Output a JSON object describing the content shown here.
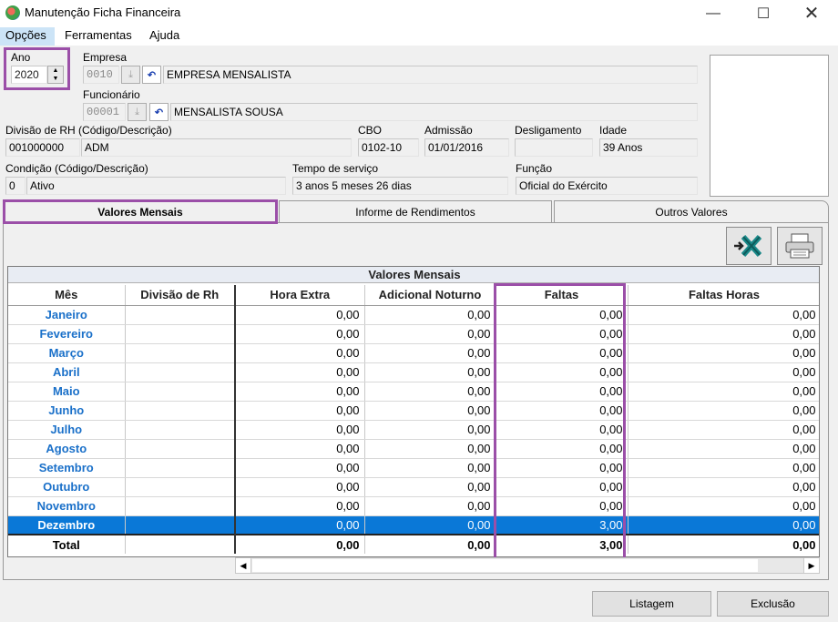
{
  "window": {
    "title": "Manutenção Ficha Financeira",
    "minimize_icon": "minimize-icon",
    "maximize_icon": "maximize-icon",
    "close_icon": "close-icon"
  },
  "menu": [
    "Opções",
    "Ferramentas",
    "Ajuda"
  ],
  "form": {
    "ano_label": "Ano",
    "ano_value": "2020",
    "empresa_label": "Empresa",
    "empresa_code": "0010",
    "empresa_name": "EMPRESA MENSALISTA",
    "funcionario_label": "Funcionário",
    "funcionario_code": "00001",
    "funcionario_name": "MENSALISTA SOUSA",
    "divisao_label": "Divisão de RH (Código/Descrição)",
    "divisao_code": "001000000",
    "divisao_desc": "ADM",
    "cbo_label": "CBO",
    "cbo_value": "0102-10",
    "admissao_label": "Admissão",
    "admissao_value": "01/01/2016",
    "desligamento_label": "Desligamento",
    "desligamento_value": "",
    "idade_label": "Idade",
    "idade_value": "39 Anos",
    "condicao_label": "Condição (Código/Descrição)",
    "condicao_code": "0",
    "condicao_desc": "Ativo",
    "tempo_label": "Tempo de serviço",
    "tempo_value": "3 anos 5 meses 26 dias",
    "funcao_label": "Função",
    "funcao_value": "Oficial do Exército"
  },
  "tabs": [
    "Valores Mensais",
    "Informe de Rendimentos",
    "Outros Valores"
  ],
  "grid": {
    "caption": "Valores Mensais",
    "columns": [
      "Mês",
      "Divisão de Rh",
      "Hora Extra",
      "Adicional Noturno",
      "Faltas",
      "Faltas Horas"
    ],
    "rows": [
      {
        "mes": "Janeiro",
        "divisao": "",
        "hora_extra": "0,00",
        "adicional": "0,00",
        "faltas": "0,00",
        "faltas_horas": "0,00"
      },
      {
        "mes": "Fevereiro",
        "divisao": "",
        "hora_extra": "0,00",
        "adicional": "0,00",
        "faltas": "0,00",
        "faltas_horas": "0,00"
      },
      {
        "mes": "Março",
        "divisao": "",
        "hora_extra": "0,00",
        "adicional": "0,00",
        "faltas": "0,00",
        "faltas_horas": "0,00"
      },
      {
        "mes": "Abril",
        "divisao": "",
        "hora_extra": "0,00",
        "adicional": "0,00",
        "faltas": "0,00",
        "faltas_horas": "0,00"
      },
      {
        "mes": "Maio",
        "divisao": "",
        "hora_extra": "0,00",
        "adicional": "0,00",
        "faltas": "0,00",
        "faltas_horas": "0,00"
      },
      {
        "mes": "Junho",
        "divisao": "",
        "hora_extra": "0,00",
        "adicional": "0,00",
        "faltas": "0,00",
        "faltas_horas": "0,00"
      },
      {
        "mes": "Julho",
        "divisao": "",
        "hora_extra": "0,00",
        "adicional": "0,00",
        "faltas": "0,00",
        "faltas_horas": "0,00"
      },
      {
        "mes": "Agosto",
        "divisao": "",
        "hora_extra": "0,00",
        "adicional": "0,00",
        "faltas": "0,00",
        "faltas_horas": "0,00"
      },
      {
        "mes": "Setembro",
        "divisao": "",
        "hora_extra": "0,00",
        "adicional": "0,00",
        "faltas": "0,00",
        "faltas_horas": "0,00"
      },
      {
        "mes": "Outubro",
        "divisao": "",
        "hora_extra": "0,00",
        "adicional": "0,00",
        "faltas": "0,00",
        "faltas_horas": "0,00"
      },
      {
        "mes": "Novembro",
        "divisao": "",
        "hora_extra": "0,00",
        "adicional": "0,00",
        "faltas": "0,00",
        "faltas_horas": "0,00"
      },
      {
        "mes": "Dezembro",
        "divisao": "",
        "hora_extra": "0,00",
        "adicional": "0,00",
        "faltas": "3,00",
        "faltas_horas": "0,00"
      }
    ],
    "total": {
      "mes": "Total",
      "divisao": "",
      "hora_extra": "0,00",
      "adicional": "0,00",
      "faltas": "3,00",
      "faltas_horas": "0,00"
    },
    "selected_row": 11
  },
  "toolbar_icons": [
    "excel-export-icon",
    "printer-icon"
  ],
  "buttons": {
    "listagem": "Listagem",
    "exclusao": "Exclusão"
  },
  "colors": {
    "highlight": "#9b4fa8",
    "selection": "#0a78d7",
    "month_text": "#1a70c9"
  }
}
